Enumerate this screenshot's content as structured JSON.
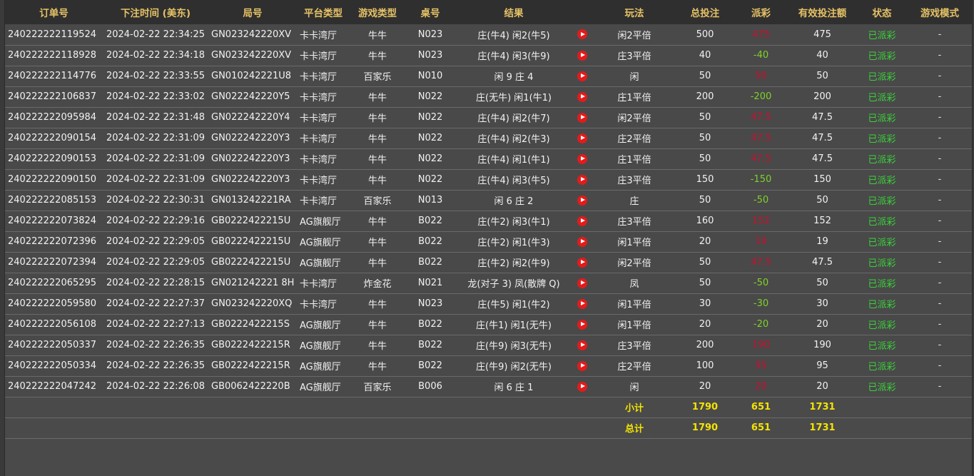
{
  "table": {
    "headers": [
      "订单号",
      "下注时间 (美东)",
      "局号",
      "平台类型",
      "游戏类型",
      "桌号",
      "结果",
      "",
      "玩法",
      "总投注",
      "派彩",
      "有效投注额",
      "状态",
      "游戏模式"
    ],
    "rows": [
      {
        "order": "240222222119524",
        "time": "2024-02-22 22:34:25",
        "round": "GN023242220XV",
        "platform": "卡卡湾厅",
        "game": "牛牛",
        "table": "N023",
        "result": "庄(牛4) 闲2(牛5)",
        "play": "闲2平倍",
        "bet": "500",
        "payout": "475",
        "payout_kind": "win",
        "valid": "475",
        "status": "已派彩",
        "mode": "-"
      },
      {
        "order": "240222222118928",
        "time": "2024-02-22 22:34:18",
        "round": "GN023242220XV",
        "platform": "卡卡湾厅",
        "game": "牛牛",
        "table": "N023",
        "result": "庄(牛4) 闲3(牛9)",
        "play": "庄3平倍",
        "bet": "40",
        "payout": "-40",
        "payout_kind": "loss",
        "valid": "40",
        "status": "已派彩",
        "mode": "-"
      },
      {
        "order": "240222222114776",
        "time": "2024-02-22 22:33:55",
        "round": "GN010242221U8",
        "platform": "卡卡湾厅",
        "game": "百家乐",
        "table": "N010",
        "result": "闲 9 庄 4",
        "play": "闲",
        "bet": "50",
        "payout": "50",
        "payout_kind": "win",
        "valid": "50",
        "status": "已派彩",
        "mode": "-"
      },
      {
        "order": "240222222106837",
        "time": "2024-02-22 22:33:02",
        "round": "GN022242220Y5",
        "platform": "卡卡湾厅",
        "game": "牛牛",
        "table": "N022",
        "result": "庄(无牛) 闲1(牛1)",
        "play": "庄1平倍",
        "bet": "200",
        "payout": "-200",
        "payout_kind": "loss",
        "valid": "200",
        "status": "已派彩",
        "mode": "-"
      },
      {
        "order": "240222222095984",
        "time": "2024-02-22 22:31:48",
        "round": "GN022242220Y4",
        "platform": "卡卡湾厅",
        "game": "牛牛",
        "table": "N022",
        "result": "庄(牛4) 闲2(牛7)",
        "play": "闲2平倍",
        "bet": "50",
        "payout": "47.5",
        "payout_kind": "win",
        "valid": "47.5",
        "status": "已派彩",
        "mode": "-"
      },
      {
        "order": "240222222090154",
        "time": "2024-02-22 22:31:09",
        "round": "GN022242220Y3",
        "platform": "卡卡湾厅",
        "game": "牛牛",
        "table": "N022",
        "result": "庄(牛4) 闲2(牛3)",
        "play": "庄2平倍",
        "bet": "50",
        "payout": "47.5",
        "payout_kind": "win",
        "valid": "47.5",
        "status": "已派彩",
        "mode": "-"
      },
      {
        "order": "240222222090153",
        "time": "2024-02-22 22:31:09",
        "round": "GN022242220Y3",
        "platform": "卡卡湾厅",
        "game": "牛牛",
        "table": "N022",
        "result": "庄(牛4) 闲1(牛1)",
        "play": "庄1平倍",
        "bet": "50",
        "payout": "47.5",
        "payout_kind": "win",
        "valid": "47.5",
        "status": "已派彩",
        "mode": "-"
      },
      {
        "order": "240222222090150",
        "time": "2024-02-22 22:31:09",
        "round": "GN022242220Y3",
        "platform": "卡卡湾厅",
        "game": "牛牛",
        "table": "N022",
        "result": "庄(牛4) 闲3(牛5)",
        "play": "庄3平倍",
        "bet": "150",
        "payout": "-150",
        "payout_kind": "loss",
        "valid": "150",
        "status": "已派彩",
        "mode": "-"
      },
      {
        "order": "240222222085153",
        "time": "2024-02-22 22:30:31",
        "round": "GN013242221RA",
        "platform": "卡卡湾厅",
        "game": "百家乐",
        "table": "N013",
        "result": "闲 6 庄 2",
        "play": "庄",
        "bet": "50",
        "payout": "-50",
        "payout_kind": "loss",
        "valid": "50",
        "status": "已派彩",
        "mode": "-"
      },
      {
        "order": "240222222073824",
        "time": "2024-02-22 22:29:16",
        "round": "GB0222422215U",
        "platform": "AG旗舰厅",
        "game": "牛牛",
        "table": "B022",
        "result": "庄(牛2) 闲3(牛1)",
        "play": "庄3平倍",
        "bet": "160",
        "payout": "152",
        "payout_kind": "win",
        "valid": "152",
        "status": "已派彩",
        "mode": "-"
      },
      {
        "order": "240222222072396",
        "time": "2024-02-22 22:29:05",
        "round": "GB0222422215U",
        "platform": "AG旗舰厅",
        "game": "牛牛",
        "table": "B022",
        "result": "庄(牛2) 闲1(牛3)",
        "play": "闲1平倍",
        "bet": "20",
        "payout": "19",
        "payout_kind": "win",
        "valid": "19",
        "status": "已派彩",
        "mode": "-"
      },
      {
        "order": "240222222072394",
        "time": "2024-02-22 22:29:05",
        "round": "GB0222422215U",
        "platform": "AG旗舰厅",
        "game": "牛牛",
        "table": "B022",
        "result": "庄(牛2) 闲2(牛9)",
        "play": "闲2平倍",
        "bet": "50",
        "payout": "47.5",
        "payout_kind": "win",
        "valid": "47.5",
        "status": "已派彩",
        "mode": "-"
      },
      {
        "order": "240222222065295",
        "time": "2024-02-22 22:28:15",
        "round": "GN021242221 8H",
        "platform": "卡卡湾厅",
        "game": "炸金花",
        "table": "N021",
        "result": "龙(对子 3) 凤(散牌 Q)",
        "play": "凤",
        "bet": "50",
        "payout": "-50",
        "payout_kind": "loss",
        "valid": "50",
        "status": "已派彩",
        "mode": "-"
      },
      {
        "order": "240222222059580",
        "time": "2024-02-22 22:27:37",
        "round": "GN023242220XQ",
        "platform": "卡卡湾厅",
        "game": "牛牛",
        "table": "N023",
        "result": "庄(牛5) 闲1(牛2)",
        "play": "闲1平倍",
        "bet": "30",
        "payout": "-30",
        "payout_kind": "loss",
        "valid": "30",
        "status": "已派彩",
        "mode": "-"
      },
      {
        "order": "240222222056108",
        "time": "2024-02-22 22:27:13",
        "round": "GB0222422215S",
        "platform": "AG旗舰厅",
        "game": "牛牛",
        "table": "B022",
        "result": "庄(牛1) 闲1(无牛)",
        "play": "闲1平倍",
        "bet": "20",
        "payout": "-20",
        "payout_kind": "loss",
        "valid": "20",
        "status": "已派彩",
        "mode": "-"
      },
      {
        "order": "240222222050337",
        "time": "2024-02-22 22:26:35",
        "round": "GB0222422215R",
        "platform": "AG旗舰厅",
        "game": "牛牛",
        "table": "B022",
        "result": "庄(牛9) 闲3(无牛)",
        "play": "庄3平倍",
        "bet": "200",
        "payout": "190",
        "payout_kind": "win",
        "valid": "190",
        "status": "已派彩",
        "mode": "-"
      },
      {
        "order": "240222222050334",
        "time": "2024-02-22 22:26:35",
        "round": "GB0222422215R",
        "platform": "AG旗舰厅",
        "game": "牛牛",
        "table": "B022",
        "result": "庄(牛9) 闲2(无牛)",
        "play": "庄2平倍",
        "bet": "100",
        "payout": "95",
        "payout_kind": "win",
        "valid": "95",
        "status": "已派彩",
        "mode": "-"
      },
      {
        "order": "240222222047242",
        "time": "2024-02-22 22:26:08",
        "round": "GB0062422220B",
        "platform": "AG旗舰厅",
        "game": "百家乐",
        "table": "B006",
        "result": "闲 6 庄 1",
        "play": "闲",
        "bet": "20",
        "payout": "20",
        "payout_kind": "win",
        "valid": "20",
        "status": "已派彩",
        "mode": "-"
      }
    ],
    "subtotal": {
      "label": "小计",
      "bet": "1790",
      "payout": "651",
      "valid": "1731"
    },
    "total": {
      "label": "总计",
      "bet": "1790",
      "payout": "651",
      "valid": "1731"
    }
  },
  "colors": {
    "header_text": "#e6c266",
    "loss_payout": "#7fd12a",
    "win_payout": "#c8102e",
    "status_text": "#3ad13a",
    "summary_text": "#f5e400",
    "play_icon": "#e31b1b"
  },
  "icons": {
    "result_replay": "play-circle-icon"
  }
}
